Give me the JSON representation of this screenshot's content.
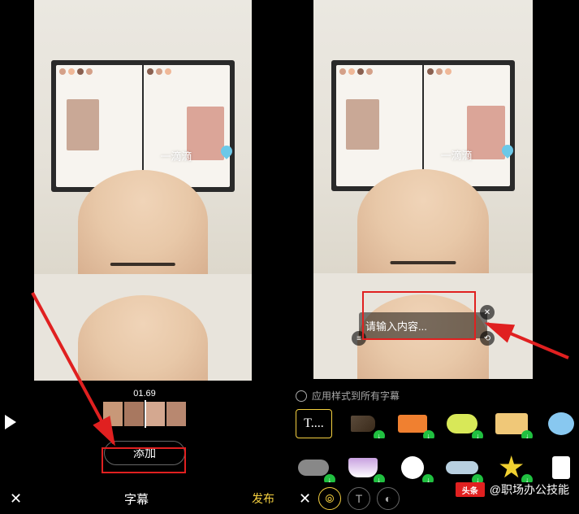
{
  "left": {
    "timecode": "01.69",
    "add_button": "添加",
    "bottom_title": "字幕",
    "publish": "发布",
    "watermark": "一滴滴"
  },
  "right": {
    "text_placeholder": "请输入内容...",
    "apply_all": "应用样式到所有字幕",
    "watermark": "一滴滴",
    "styles": {
      "text_default": "T...."
    }
  },
  "footer": {
    "logo": "头条",
    "handle": "@职场办公技能"
  }
}
